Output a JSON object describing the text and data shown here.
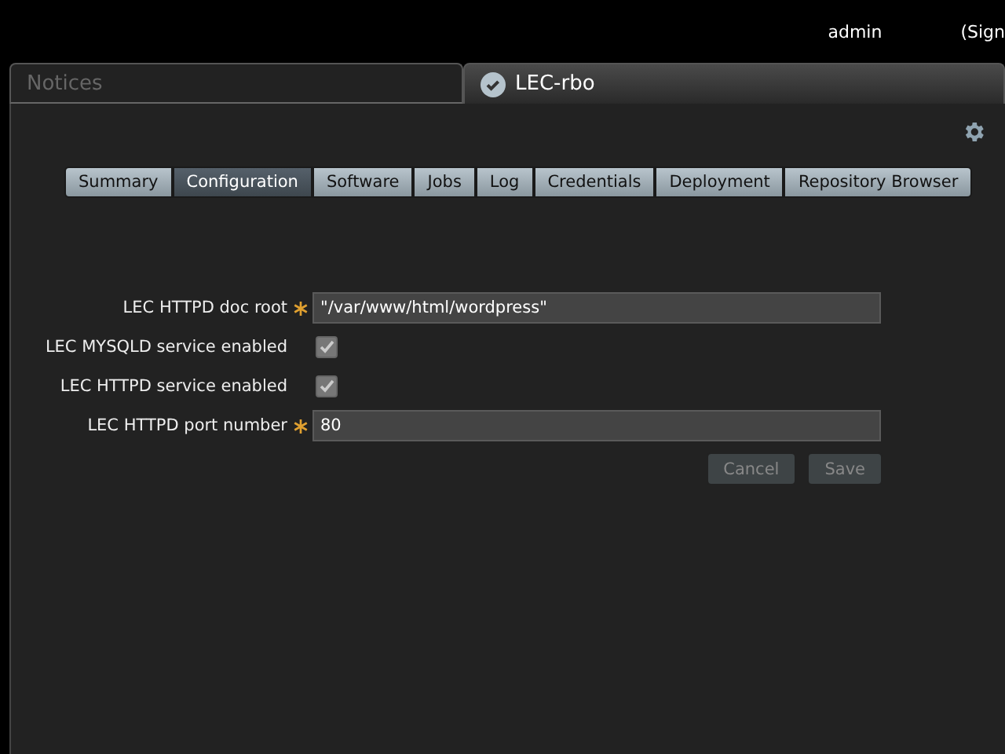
{
  "header": {
    "user": "admin",
    "sign_out": "(Sign"
  },
  "page_tabs": [
    {
      "label": "Notices",
      "selected": false,
      "status_icon": false
    },
    {
      "label": "LEC-rbo",
      "selected": true,
      "status_icon": true
    }
  ],
  "tabs": [
    {
      "label": "Summary",
      "selected": false
    },
    {
      "label": "Configuration",
      "selected": true
    },
    {
      "label": "Software",
      "selected": false
    },
    {
      "label": "Jobs",
      "selected": false
    },
    {
      "label": "Log",
      "selected": false
    },
    {
      "label": "Credentials",
      "selected": false
    },
    {
      "label": "Deployment",
      "selected": false
    },
    {
      "label": "Repository Browser",
      "selected": false
    }
  ],
  "form": {
    "fields": [
      {
        "kind": "text",
        "label": "LEC HTTPD doc root",
        "required": true,
        "value": "\"/var/www/html/wordpress\""
      },
      {
        "kind": "checkbox",
        "label": "LEC MYSQLD service enabled",
        "required": false,
        "checked": true
      },
      {
        "kind": "checkbox",
        "label": "LEC HTTPD service enabled",
        "required": false,
        "checked": true
      },
      {
        "kind": "text",
        "label": "LEC HTTPD port number",
        "required": true,
        "value": "80"
      }
    ],
    "buttons": [
      "Cancel",
      "Save"
    ]
  }
}
